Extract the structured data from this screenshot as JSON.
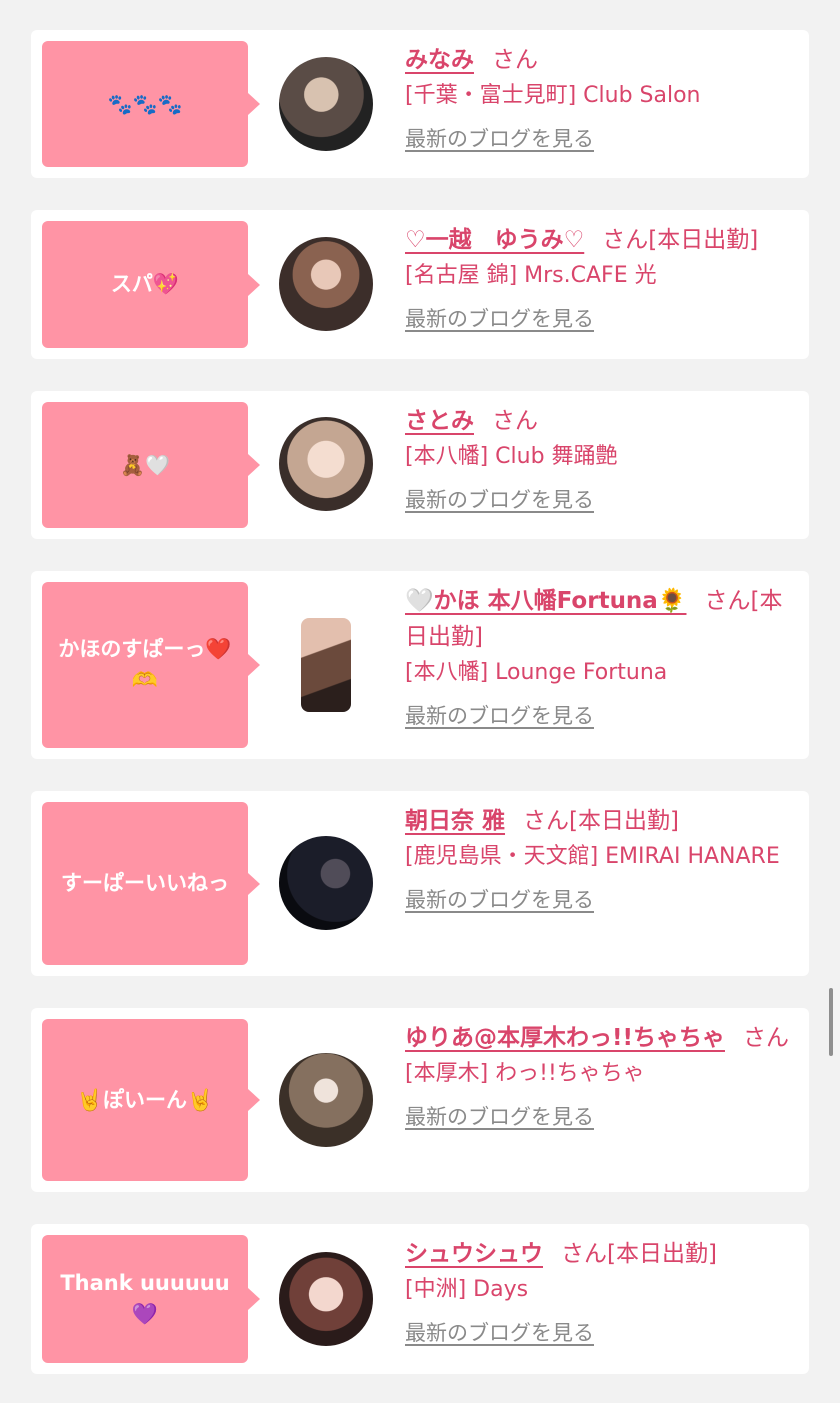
{
  "entries": [
    {
      "badge": "🐾🐾🐾",
      "name": "みなみ",
      "san": "さん",
      "shop": "[千葉・富士見町] Club Salon",
      "blog": "最新のブログを見る",
      "avatar_bg": "#2b2a2c"
    },
    {
      "badge": "スパ💖",
      "name": "♡一越　ゆうみ♡",
      "san": "さん[本日出勤]",
      "shop": "[名古屋 錦] Mrs.CAFE 光",
      "blog": "最新のブログを見る",
      "avatar_bg": "#6b5046"
    },
    {
      "badge": "🧸🤍",
      "name": "さとみ",
      "san": "さん",
      "shop": "[本八幡] Club 舞踊艶",
      "blog": "最新のブログを見る",
      "avatar_bg": "#b99a8a"
    },
    {
      "badge": "かほのすぱーっ❤️🫶",
      "name": "🤍かほ 本八幡Fortuna🌻",
      "san": "さん[本日出勤]",
      "shop": "[本八幡] Lounge Fortuna",
      "blog": "最新のブログを見る",
      "avatar_bg": "#8b6b5a"
    },
    {
      "badge": "すーぱーいいねっ",
      "name": "朝日奈 雅",
      "san": "さん[本日出勤]",
      "shop": "[鹿児島県・天文館] EMIRAI HANARE",
      "blog": "最新のブログを見る",
      "avatar_bg": "#14161f"
    },
    {
      "badge": "🤘ぽいーん🤘",
      "name": "ゆりあ@本厚木わっ!!ちゃちゃ",
      "san": "さん",
      "shop": "[本厚木] わっ!!ちゃちゃ",
      "blog": "最新のブログを見る",
      "avatar_bg": "#6d5a4e"
    },
    {
      "badge": "Thank uuuuuu💜",
      "name": "シュウシュウ",
      "san": "さん[本日出勤]",
      "shop": "[中洲] Days",
      "blog": "最新のブログを見る",
      "avatar_bg": "#5a3a34"
    }
  ]
}
